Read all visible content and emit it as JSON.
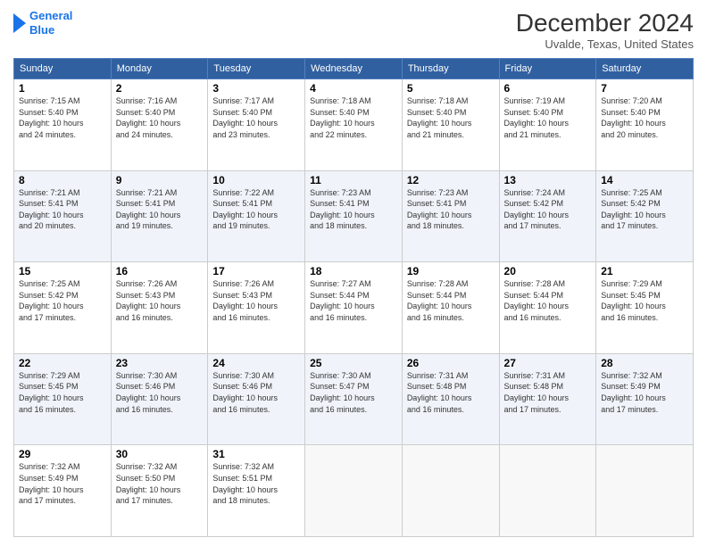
{
  "header": {
    "logo_line1": "General",
    "logo_line2": "Blue",
    "month": "December 2024",
    "location": "Uvalde, Texas, United States"
  },
  "days_of_week": [
    "Sunday",
    "Monday",
    "Tuesday",
    "Wednesday",
    "Thursday",
    "Friday",
    "Saturday"
  ],
  "weeks": [
    [
      {
        "day": "1",
        "sunrise": "7:15 AM",
        "sunset": "5:40 PM",
        "daylight": "10 hours and 24 minutes."
      },
      {
        "day": "2",
        "sunrise": "7:16 AM",
        "sunset": "5:40 PM",
        "daylight": "10 hours and 24 minutes."
      },
      {
        "day": "3",
        "sunrise": "7:17 AM",
        "sunset": "5:40 PM",
        "daylight": "10 hours and 23 minutes."
      },
      {
        "day": "4",
        "sunrise": "7:18 AM",
        "sunset": "5:40 PM",
        "daylight": "10 hours and 22 minutes."
      },
      {
        "day": "5",
        "sunrise": "7:18 AM",
        "sunset": "5:40 PM",
        "daylight": "10 hours and 21 minutes."
      },
      {
        "day": "6",
        "sunrise": "7:19 AM",
        "sunset": "5:40 PM",
        "daylight": "10 hours and 21 minutes."
      },
      {
        "day": "7",
        "sunrise": "7:20 AM",
        "sunset": "5:40 PM",
        "daylight": "10 hours and 20 minutes."
      }
    ],
    [
      {
        "day": "8",
        "sunrise": "7:21 AM",
        "sunset": "5:41 PM",
        "daylight": "10 hours and 20 minutes."
      },
      {
        "day": "9",
        "sunrise": "7:21 AM",
        "sunset": "5:41 PM",
        "daylight": "10 hours and 19 minutes."
      },
      {
        "day": "10",
        "sunrise": "7:22 AM",
        "sunset": "5:41 PM",
        "daylight": "10 hours and 19 minutes."
      },
      {
        "day": "11",
        "sunrise": "7:23 AM",
        "sunset": "5:41 PM",
        "daylight": "10 hours and 18 minutes."
      },
      {
        "day": "12",
        "sunrise": "7:23 AM",
        "sunset": "5:41 PM",
        "daylight": "10 hours and 18 minutes."
      },
      {
        "day": "13",
        "sunrise": "7:24 AM",
        "sunset": "5:42 PM",
        "daylight": "10 hours and 17 minutes."
      },
      {
        "day": "14",
        "sunrise": "7:25 AM",
        "sunset": "5:42 PM",
        "daylight": "10 hours and 17 minutes."
      }
    ],
    [
      {
        "day": "15",
        "sunrise": "7:25 AM",
        "sunset": "5:42 PM",
        "daylight": "10 hours and 17 minutes."
      },
      {
        "day": "16",
        "sunrise": "7:26 AM",
        "sunset": "5:43 PM",
        "daylight": "10 hours and 16 minutes."
      },
      {
        "day": "17",
        "sunrise": "7:26 AM",
        "sunset": "5:43 PM",
        "daylight": "10 hours and 16 minutes."
      },
      {
        "day": "18",
        "sunrise": "7:27 AM",
        "sunset": "5:44 PM",
        "daylight": "10 hours and 16 minutes."
      },
      {
        "day": "19",
        "sunrise": "7:28 AM",
        "sunset": "5:44 PM",
        "daylight": "10 hours and 16 minutes."
      },
      {
        "day": "20",
        "sunrise": "7:28 AM",
        "sunset": "5:44 PM",
        "daylight": "10 hours and 16 minutes."
      },
      {
        "day": "21",
        "sunrise": "7:29 AM",
        "sunset": "5:45 PM",
        "daylight": "10 hours and 16 minutes."
      }
    ],
    [
      {
        "day": "22",
        "sunrise": "7:29 AM",
        "sunset": "5:45 PM",
        "daylight": "10 hours and 16 minutes."
      },
      {
        "day": "23",
        "sunrise": "7:30 AM",
        "sunset": "5:46 PM",
        "daylight": "10 hours and 16 minutes."
      },
      {
        "day": "24",
        "sunrise": "7:30 AM",
        "sunset": "5:46 PM",
        "daylight": "10 hours and 16 minutes."
      },
      {
        "day": "25",
        "sunrise": "7:30 AM",
        "sunset": "5:47 PM",
        "daylight": "10 hours and 16 minutes."
      },
      {
        "day": "26",
        "sunrise": "7:31 AM",
        "sunset": "5:48 PM",
        "daylight": "10 hours and 16 minutes."
      },
      {
        "day": "27",
        "sunrise": "7:31 AM",
        "sunset": "5:48 PM",
        "daylight": "10 hours and 17 minutes."
      },
      {
        "day": "28",
        "sunrise": "7:32 AM",
        "sunset": "5:49 PM",
        "daylight": "10 hours and 17 minutes."
      }
    ],
    [
      {
        "day": "29",
        "sunrise": "7:32 AM",
        "sunset": "5:49 PM",
        "daylight": "10 hours and 17 minutes."
      },
      {
        "day": "30",
        "sunrise": "7:32 AM",
        "sunset": "5:50 PM",
        "daylight": "10 hours and 17 minutes."
      },
      {
        "day": "31",
        "sunrise": "7:32 AM",
        "sunset": "5:51 PM",
        "daylight": "10 hours and 18 minutes."
      },
      null,
      null,
      null,
      null
    ]
  ]
}
